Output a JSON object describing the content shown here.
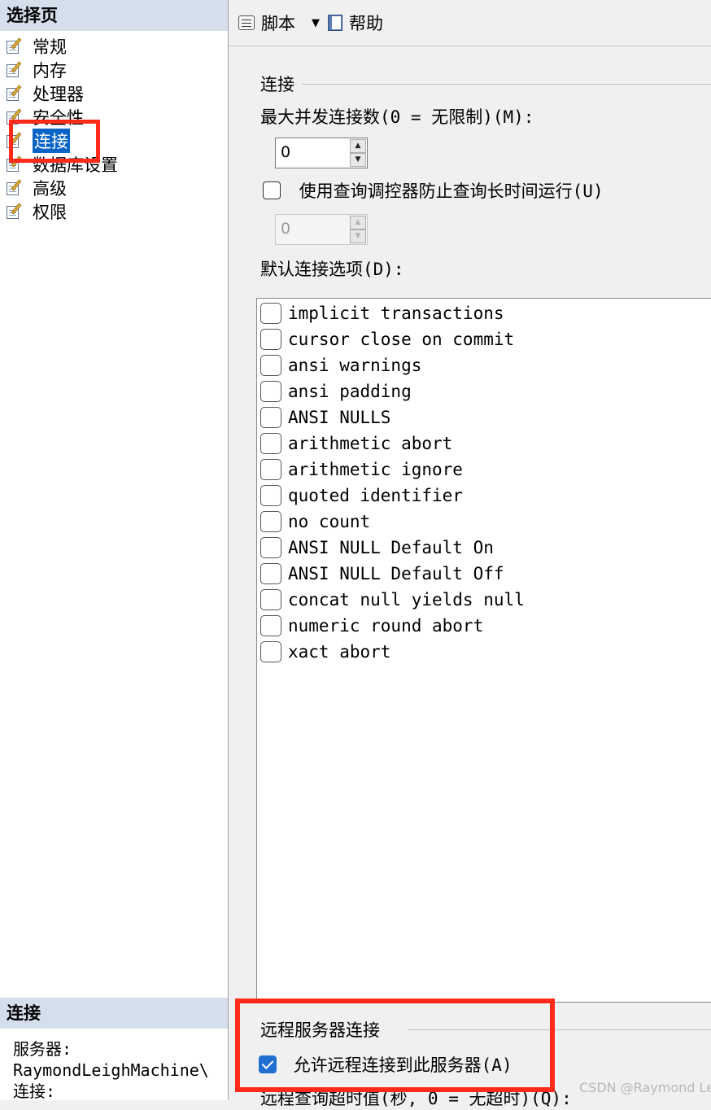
{
  "left_pane": {
    "select_page_header": "选择页",
    "pages": [
      {
        "label": "常规"
      },
      {
        "label": "内存"
      },
      {
        "label": "处理器"
      },
      {
        "label": "安全性"
      },
      {
        "label": "连接",
        "selected": true
      },
      {
        "label": "数据库设置"
      },
      {
        "label": "高级"
      },
      {
        "label": "权限"
      }
    ],
    "connection_header": "连接",
    "server_label": "服务器:",
    "server_value": "RaymondLeighMachine\\",
    "connection_label": "连接:"
  },
  "toolbar": {
    "script_label": "脚本",
    "help_label": "帮助"
  },
  "connections": {
    "group_title": "连接",
    "max_conn_label": "最大并发连接数(0 = 无限制)(M):",
    "max_conn_value": "0",
    "query_governor_label": "使用查询调控器防止查询长时间运行(U)",
    "query_governor_checked": false,
    "query_governor_value": "0",
    "default_options_label": "默认连接选项(D):",
    "options": [
      {
        "label": "implicit transactions",
        "checked": false
      },
      {
        "label": "cursor close on commit",
        "checked": false
      },
      {
        "label": "ansi warnings",
        "checked": false
      },
      {
        "label": "ansi padding",
        "checked": false
      },
      {
        "label": "ANSI NULLS",
        "checked": false
      },
      {
        "label": "arithmetic abort",
        "checked": false
      },
      {
        "label": "arithmetic ignore",
        "checked": false
      },
      {
        "label": "quoted identifier",
        "checked": false
      },
      {
        "label": "no count",
        "checked": false
      },
      {
        "label": "ANSI NULL Default On",
        "checked": false
      },
      {
        "label": "ANSI NULL Default Off",
        "checked": false
      },
      {
        "label": "concat null yields null",
        "checked": false
      },
      {
        "label": "numeric round abort",
        "checked": false
      },
      {
        "label": "xact abort",
        "checked": false
      }
    ]
  },
  "remote": {
    "group_title": "远程服务器连接",
    "allow_label": "允许远程连接到此服务器(A)",
    "allow_checked": true,
    "timeout_label": "远程查询超时值(秒, 0 = 无超时)(Q):"
  },
  "watermark": "CSDN @Raymond Leigh",
  "colors": {
    "highlight_border": "#ff2a1a",
    "selection": "#0a64c8",
    "header_bg": "#d5dfec",
    "checkbox_checked": "#1f6fd1"
  }
}
